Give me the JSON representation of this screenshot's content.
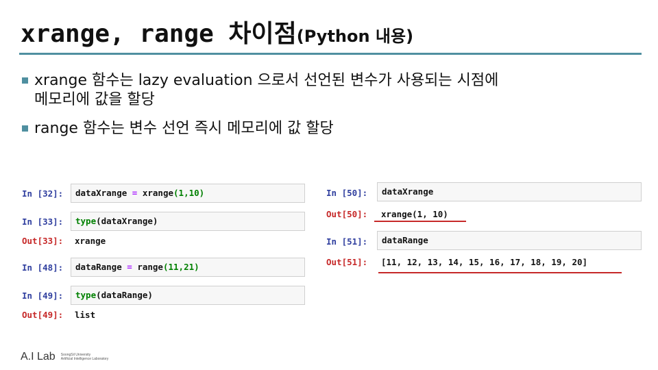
{
  "slide": {
    "title_main": "xrange, range 차이점",
    "title_sub": "(Python 내용)"
  },
  "bullets": [
    {
      "line1": "xrange 함수는 lazy evaluation 으로서 선언된 변수가 사용되는 시점에",
      "line2": "메모리에 값을 할당"
    },
    {
      "line1": "range 함수는 변수 선언 즉시 메모리에 값 할당"
    }
  ],
  "left_cells": [
    {
      "in_label": "In [32]:",
      "code": {
        "a": "dataXrange ",
        "op": "=",
        "b": " ",
        "fn": "xrange",
        "args": "(1,10)"
      }
    },
    {
      "in_label": "In [33]:",
      "code": {
        "kw": "type",
        "rest": "(dataXrange)"
      },
      "out_label": "Out[33]:",
      "out": "xrange"
    },
    {
      "in_label": "In [48]:",
      "code": {
        "a": "dataRange ",
        "op": "=",
        "b": " ",
        "fn": "range",
        "args": "(11,21)"
      }
    },
    {
      "in_label": "In [49]:",
      "code": {
        "kw": "type",
        "rest": "(dataRange)"
      },
      "out_label": "Out[49]:",
      "out": "list"
    }
  ],
  "right_cells": [
    {
      "in_label": "In [50]:",
      "code": "dataXrange",
      "out_label": "Out[50]:",
      "out": "xrange(1, 10)"
    },
    {
      "in_label": "In [51]:",
      "code": "dataRange",
      "out_label": "Out[51]:",
      "out": "[11, 12, 13, 14, 15, 16, 17, 18, 19, 20]"
    }
  ],
  "logo": {
    "main": "A.I Lab",
    "small_line1": "SoongSil University",
    "small_line2": "Artificial Intelligence Laboratory"
  },
  "colors": {
    "accent": "#4f8fa0",
    "in_label": "#303f9f",
    "out_label": "#c62828",
    "underline": "#c62828"
  }
}
